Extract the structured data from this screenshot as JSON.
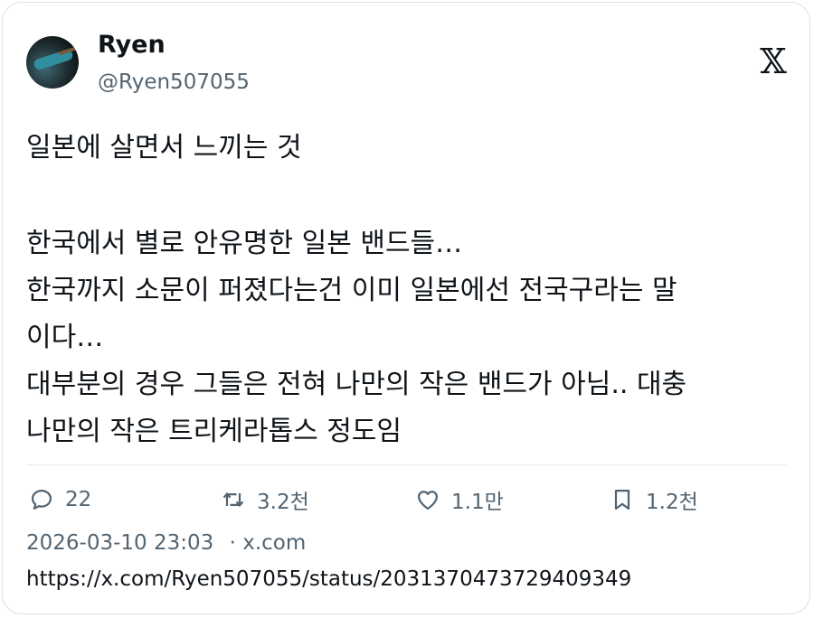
{
  "author": {
    "name": "Ryen",
    "handle": "@Ryen507055"
  },
  "tweet_lines": [
    "일본에 살면서 느끼는 것",
    "",
    "한국에서 별로 안유명한 일본 밴드들…",
    "한국까지 소문이 퍼졌다는건 이미 일본에선 전국구라는 말",
    "이다…",
    "대부분의 경우 그들은 전혀 나만의 작은 밴드가 아님.. 대충",
    "나만의 작은 트리케라톱스 정도임"
  ],
  "actions": {
    "replies": "22",
    "retweets": "3.2천",
    "likes": "1.1만",
    "bookmarks": "1.2천"
  },
  "meta": {
    "timestamp": "2026-03-10 23:03",
    "separator": "·",
    "source": "x.com"
  },
  "url": "https://x.com/Ryen507055/status/2031370473729409349",
  "icons": [
    "x-logo-icon",
    "reply-icon",
    "retweet-icon",
    "like-icon",
    "bookmark-icon"
  ]
}
